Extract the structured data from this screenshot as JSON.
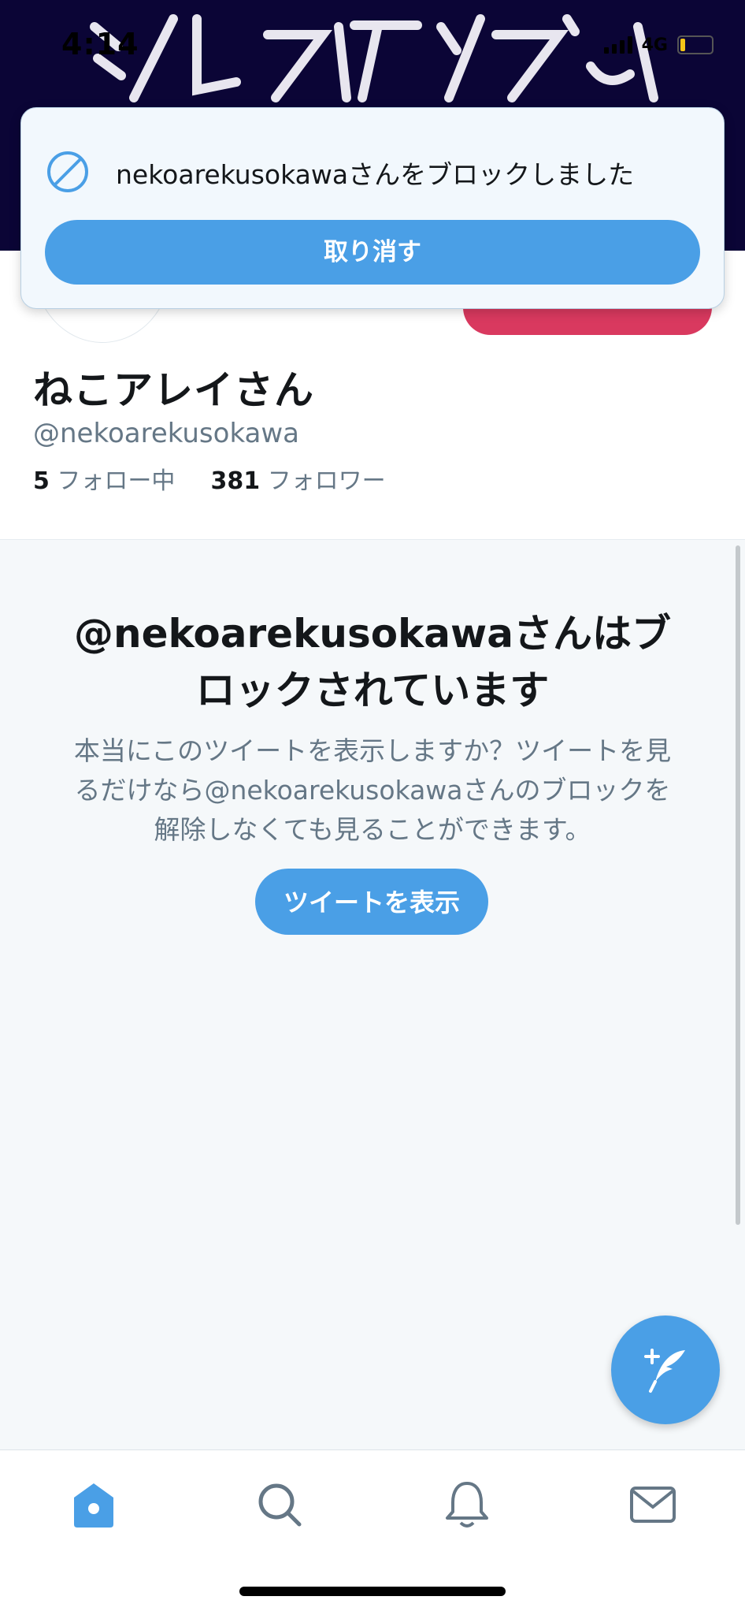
{
  "status_bar": {
    "time": "4:14",
    "network": "4G"
  },
  "toast": {
    "icon": "block-icon",
    "message": "nekoarekusokawaさんをブロックしました",
    "undo_label": "取り消す"
  },
  "profile": {
    "display_name": "ねこアレイさん",
    "handle": "@nekoarekusokawa",
    "following_count": "5",
    "following_label": "フォロー中",
    "followers_count": "381",
    "followers_label": "フォロワー",
    "action_button_color": "#d9395f"
  },
  "blocked": {
    "title": "@nekoarekusokawaさんはブロックされています",
    "description": "本当にこのツイートを表示しますか？ツイートを見るだけなら@nekoarekusokawaさんのブロックを解除しなくても見ることができます。",
    "show_button_label": "ツイートを表示"
  },
  "fab": {
    "icon": "compose-tweet-icon"
  },
  "tabs": [
    {
      "name": "home",
      "icon": "home-icon",
      "active": true
    },
    {
      "name": "search",
      "icon": "search-icon",
      "active": false
    },
    {
      "name": "notifications",
      "icon": "bell-icon",
      "active": false
    },
    {
      "name": "messages",
      "icon": "mail-icon",
      "active": false
    }
  ],
  "colors": {
    "accent": "#4a9fe6",
    "banner": "#0b0536",
    "panel_bg": "#f5f8fa",
    "muted_text": "#657786"
  }
}
